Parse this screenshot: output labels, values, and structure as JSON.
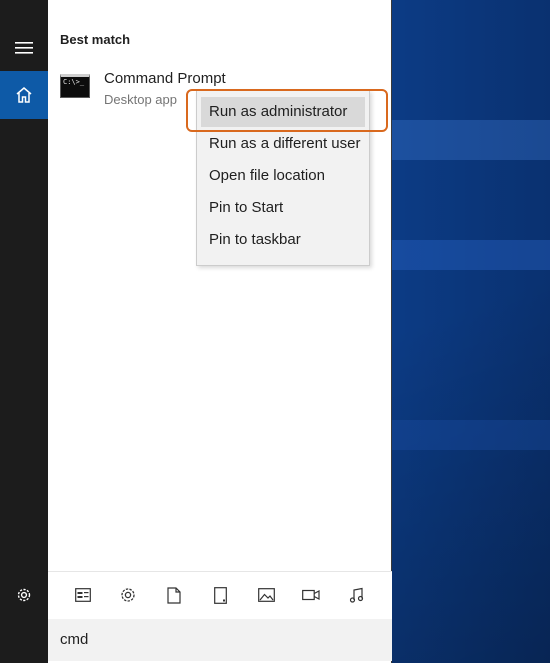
{
  "search": {
    "query": "cmd"
  },
  "results": {
    "section_title": "Best match",
    "best_match": {
      "name": "Command Prompt",
      "type": "Desktop app",
      "icon": "command-prompt-icon",
      "icon_text": "C:\\>_"
    }
  },
  "context_menu": {
    "items": [
      {
        "label": "Run as administrator",
        "highlighted": true
      },
      {
        "label": "Run as a different user"
      },
      {
        "label": "Open file location"
      },
      {
        "label": "Pin to Start"
      },
      {
        "label": "Pin to taskbar"
      }
    ]
  },
  "toolbar": {
    "filters": [
      "apps-icon",
      "settings-icon",
      "documents-icon",
      "tablet-icon",
      "photos-icon",
      "videos-icon",
      "music-icon"
    ]
  },
  "rail": {
    "items": [
      "hamburger-icon",
      "home-icon",
      "settings-icon"
    ]
  },
  "colors": {
    "accent": "#0e5aa7",
    "highlight_outline": "#d9691e",
    "rail_bg": "#1c1c1c",
    "menu_hover": "#d9d9d9"
  }
}
